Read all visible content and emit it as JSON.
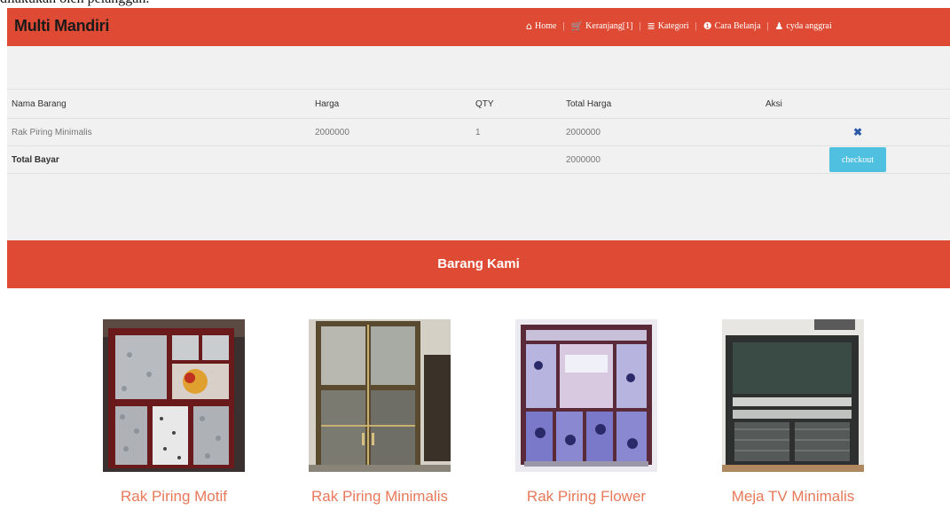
{
  "caption": "dilakukan oleh pelanggan.",
  "brand": "Multi Mandiri",
  "nav": [
    {
      "icon": "home-icon",
      "glyph": "⌂",
      "label": "Home"
    },
    {
      "icon": "cart-icon",
      "glyph": "🛒",
      "label": "Keranjang[1]"
    },
    {
      "icon": "list-icon",
      "glyph": "≣",
      "label": "Kategori"
    },
    {
      "icon": "info-icon",
      "glyph": "❶",
      "label": "Cara Belanja"
    },
    {
      "icon": "user-icon",
      "glyph": "♟",
      "label": "cyda anggrai"
    }
  ],
  "cart": {
    "headers": [
      "Nama Barang",
      "Harga",
      "QTY",
      "Total Harga",
      "Aksi"
    ],
    "rows": [
      {
        "name": "Rak Piring Minimalis",
        "price": "2000000",
        "qty": "1",
        "total": "2000000",
        "remove": "✖"
      }
    ],
    "total_label": "Total Bayar",
    "total_value": "2000000",
    "checkout_label": "checkout"
  },
  "section_title": "Barang Kami",
  "products": [
    {
      "name": "Rak Piring Motif"
    },
    {
      "name": "Rak Piring Minimalis"
    },
    {
      "name": "Rak Piring Flower"
    },
    {
      "name": "Meja TV Minimalis"
    }
  ],
  "colors": {
    "accent": "#df4a34",
    "panel": "#f1f1f1",
    "button": "#4fc0df",
    "product_link": "#e8795a"
  }
}
